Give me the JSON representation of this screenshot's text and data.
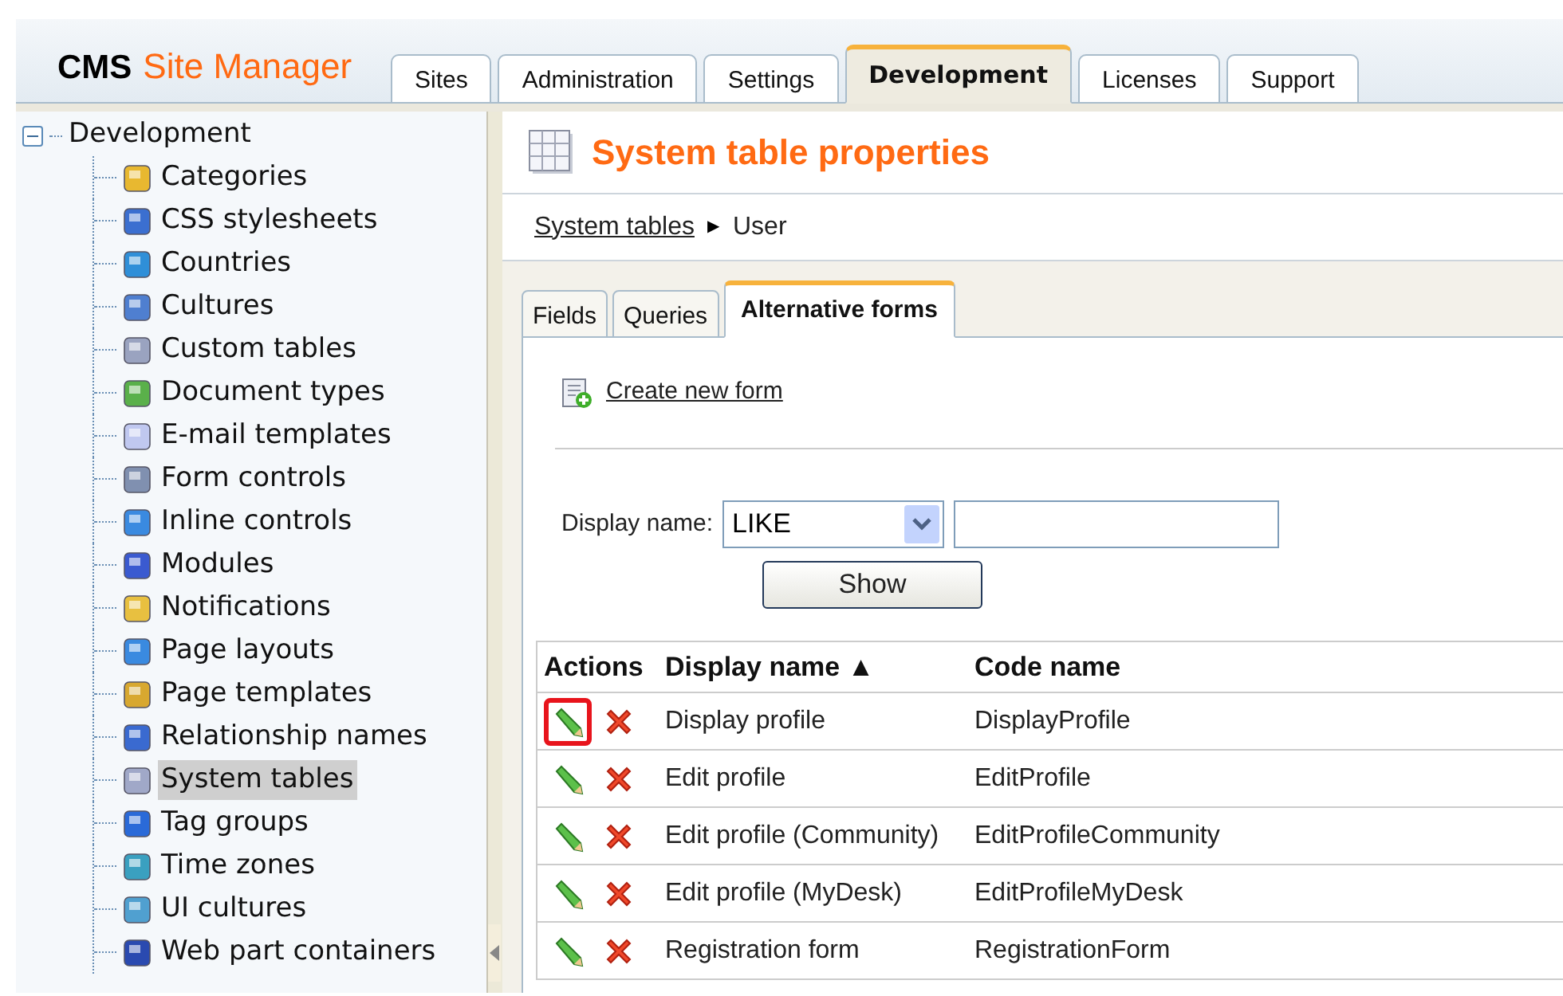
{
  "header": {
    "logo_brand": "CMS",
    "logo_product": "Site Manager"
  },
  "main_tabs": [
    {
      "label": "Sites",
      "selected": false
    },
    {
      "label": "Administration",
      "selected": false
    },
    {
      "label": "Settings",
      "selected": false
    },
    {
      "label": "Development",
      "selected": true
    },
    {
      "label": "Licenses",
      "selected": false
    },
    {
      "label": "Support",
      "selected": false
    }
  ],
  "tree": {
    "label": "Development",
    "expanded": true,
    "children": [
      {
        "label": "Categories",
        "selected": false
      },
      {
        "label": "CSS stylesheets",
        "selected": false
      },
      {
        "label": "Countries",
        "selected": false
      },
      {
        "label": "Cultures",
        "selected": false
      },
      {
        "label": "Custom tables",
        "selected": false
      },
      {
        "label": "Document types",
        "selected": false
      },
      {
        "label": "E-mail templates",
        "selected": false
      },
      {
        "label": "Form controls",
        "selected": false
      },
      {
        "label": "Inline controls",
        "selected": false
      },
      {
        "label": "Modules",
        "selected": false
      },
      {
        "label": "Notifications",
        "selected": false
      },
      {
        "label": "Page layouts",
        "selected": false
      },
      {
        "label": "Page templates",
        "selected": false
      },
      {
        "label": "Relationship names",
        "selected": false
      },
      {
        "label": "System tables",
        "selected": true
      },
      {
        "label": "Tag groups",
        "selected": false
      },
      {
        "label": "Time zones",
        "selected": false
      },
      {
        "label": "UI cultures",
        "selected": false
      },
      {
        "label": "Web part containers",
        "selected": false
      }
    ]
  },
  "page_title": "System table properties",
  "breadcrumb": {
    "link": "System tables",
    "separator": "▶",
    "current": "User"
  },
  "sub_tabs": [
    {
      "label": "Fields",
      "selected": false
    },
    {
      "label": "Queries",
      "selected": false
    },
    {
      "label": "Alternative forms",
      "selected": true
    }
  ],
  "create_link": "Create new form",
  "filter": {
    "label": "Display name:",
    "operator": "LIKE",
    "button": "Show"
  },
  "table": {
    "columns": [
      "Actions",
      "Display name ▲",
      "Code name"
    ],
    "rows": [
      {
        "display_name": "Display profile",
        "code_name": "DisplayProfile",
        "highlighted": true
      },
      {
        "display_name": "Edit profile",
        "code_name": "EditProfile",
        "highlighted": false
      },
      {
        "display_name": "Edit profile (Community)",
        "code_name": "EditProfileCommunity",
        "highlighted": false
      },
      {
        "display_name": "Edit profile (MyDesk)",
        "code_name": "EditProfileMyDesk",
        "highlighted": false
      },
      {
        "display_name": "Registration form",
        "code_name": "RegistrationForm",
        "highlighted": false
      }
    ]
  }
}
